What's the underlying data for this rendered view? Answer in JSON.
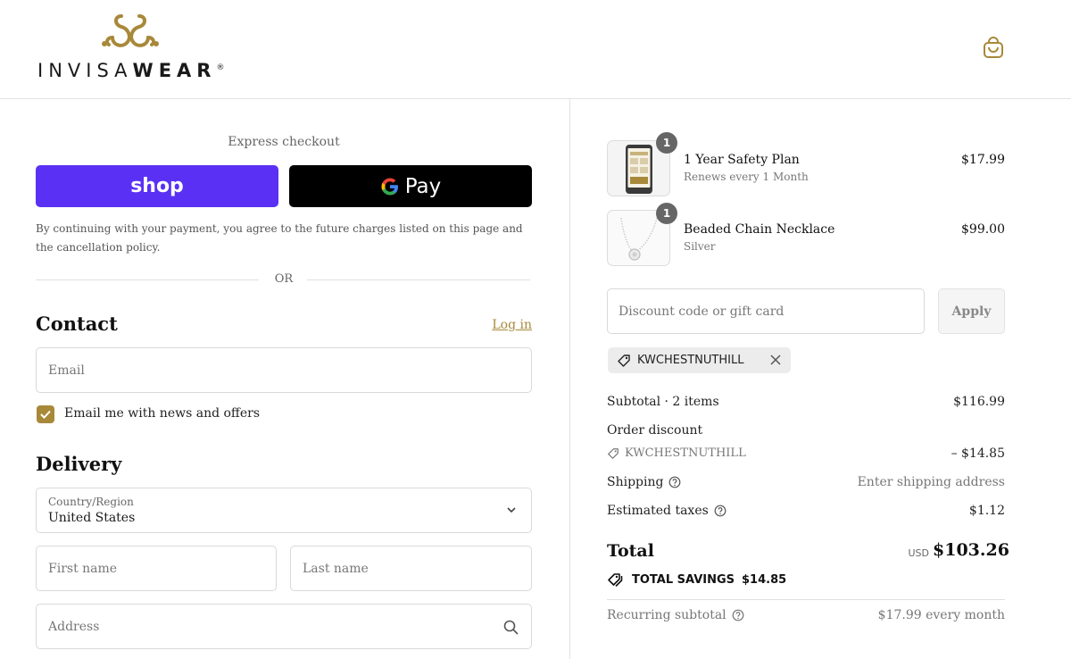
{
  "header": {
    "brand_light": "INVISA",
    "brand_bold": "WEAR",
    "brand_mark": "®",
    "accent_color": "#a8893a",
    "cart_icon": "shopping-bag-icon"
  },
  "express": {
    "title": "Express checkout",
    "shop_label": "shop",
    "gpay_label": "Pay",
    "consent_text": "By continuing with your payment, you agree to the future charges listed on this page and the cancellation policy.",
    "or_text": "OR",
    "shop_color": "#5a31f4"
  },
  "contact": {
    "heading": "Contact",
    "login_label": "Log in",
    "email_placeholder": "Email",
    "newsletter_label": "Email me with news and offers",
    "newsletter_checked": true
  },
  "delivery": {
    "heading": "Delivery",
    "country_label": "Country/Region",
    "country_value": "United States",
    "first_name_placeholder": "First name",
    "last_name_placeholder": "Last name",
    "address_placeholder": "Address"
  },
  "cart": {
    "items": [
      {
        "name": "1 Year Safety Plan",
        "sub": "Renews every 1 Month",
        "price": "$17.99",
        "qty": "1"
      },
      {
        "name": "Beaded Chain Necklace",
        "sub": "Silver",
        "price": "$99.00",
        "qty": "1"
      }
    ],
    "discount_placeholder": "Discount code or gift card",
    "apply_label": "Apply",
    "applied_code": "KWCHESTNUTHILL"
  },
  "summary": {
    "subtotal_label": "Subtotal · 2 items",
    "subtotal_value": "$116.99",
    "order_discount_label": "Order discount",
    "discount_code": "KWCHESTNUTHILL",
    "discount_value": "– $14.85",
    "shipping_label": "Shipping",
    "shipping_value": "Enter shipping address",
    "taxes_label": "Estimated taxes",
    "taxes_value": "$1.12",
    "total_label": "Total",
    "total_currency": "USD",
    "total_value": "$103.26",
    "savings_label": "TOTAL SAVINGS",
    "savings_value": "$14.85",
    "recurring_label": "Recurring subtotal",
    "recurring_value": "$17.99 every month"
  }
}
